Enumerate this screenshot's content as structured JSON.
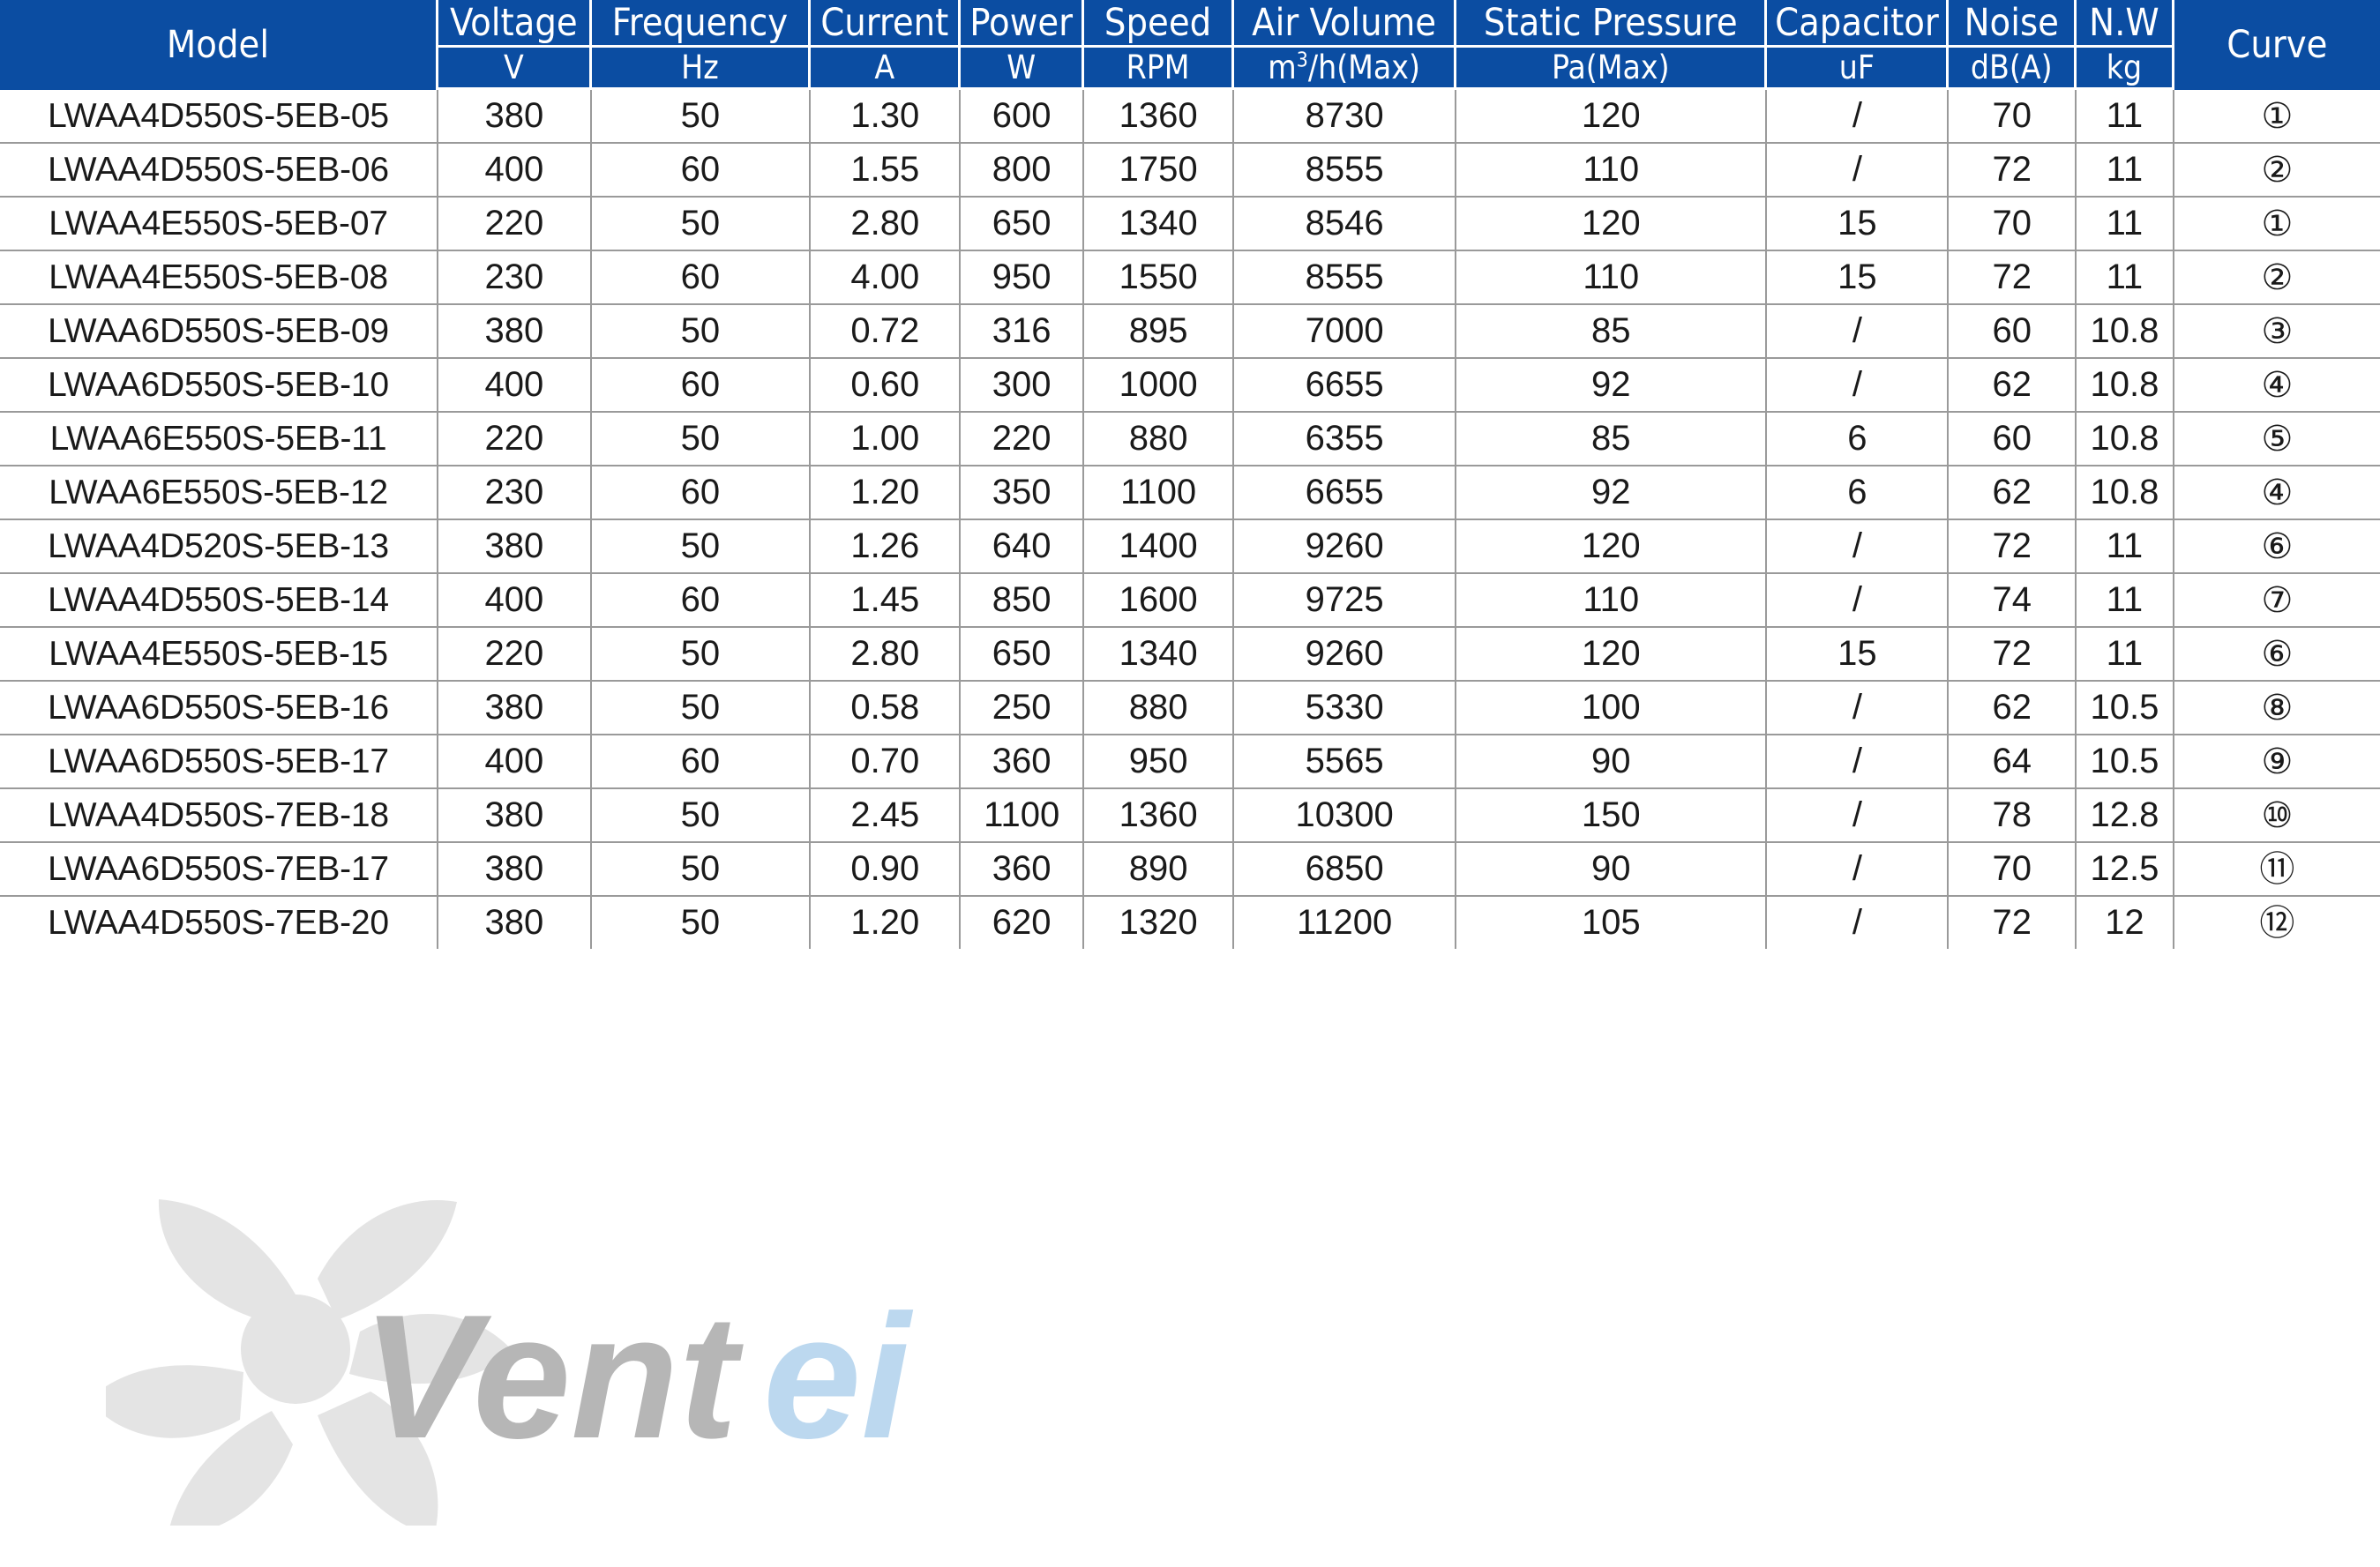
{
  "table": {
    "headers": {
      "model": "Model",
      "curve": "Curve",
      "groups": [
        {
          "name": "Voltage",
          "unit": "V"
        },
        {
          "name": "Frequency",
          "unit": "Hz"
        },
        {
          "name": "Current",
          "unit": "A"
        },
        {
          "name": "Power",
          "unit": "W"
        },
        {
          "name": "Speed",
          "unit": "RPM"
        },
        {
          "name": "Air Volume",
          "unit": "m³/h(Max)"
        },
        {
          "name": "Static Pressure",
          "unit": "Pa(Max)"
        },
        {
          "name": "Capacitor",
          "unit": "uF"
        },
        {
          "name": "Noise",
          "unit": "dB(A)"
        },
        {
          "name": "N.W",
          "unit": "kg"
        }
      ]
    },
    "rows": [
      {
        "model": "LWAA4D550S-5EB-05",
        "voltage": "380",
        "frequency": "50",
        "current": "1.30",
        "power": "600",
        "speed": "1360",
        "air_volume": "8730",
        "static_pressure": "120",
        "capacitor": "/",
        "noise": "70",
        "nw": "11",
        "curve": "①"
      },
      {
        "model": "LWAA4D550S-5EB-06",
        "voltage": "400",
        "frequency": "60",
        "current": "1.55",
        "power": "800",
        "speed": "1750",
        "air_volume": "8555",
        "static_pressure": "110",
        "capacitor": "/",
        "noise": "72",
        "nw": "11",
        "curve": "②"
      },
      {
        "model": "LWAA4E550S-5EB-07",
        "voltage": "220",
        "frequency": "50",
        "current": "2.80",
        "power": "650",
        "speed": "1340",
        "air_volume": "8546",
        "static_pressure": "120",
        "capacitor": "15",
        "noise": "70",
        "nw": "11",
        "curve": "①"
      },
      {
        "model": "LWAA4E550S-5EB-08",
        "voltage": "230",
        "frequency": "60",
        "current": "4.00",
        "power": "950",
        "speed": "1550",
        "air_volume": "8555",
        "static_pressure": "110",
        "capacitor": "15",
        "noise": "72",
        "nw": "11",
        "curve": "②"
      },
      {
        "model": "LWAA6D550S-5EB-09",
        "voltage": "380",
        "frequency": "50",
        "current": "0.72",
        "power": "316",
        "speed": "895",
        "air_volume": "7000",
        "static_pressure": "85",
        "capacitor": "/",
        "noise": "60",
        "nw": "10.8",
        "curve": "③"
      },
      {
        "model": "LWAA6D550S-5EB-10",
        "voltage": "400",
        "frequency": "60",
        "current": "0.60",
        "power": "300",
        "speed": "1000",
        "air_volume": "6655",
        "static_pressure": "92",
        "capacitor": "/",
        "noise": "62",
        "nw": "10.8",
        "curve": "④"
      },
      {
        "model": "LWAA6E550S-5EB-11",
        "voltage": "220",
        "frequency": "50",
        "current": "1.00",
        "power": "220",
        "speed": "880",
        "air_volume": "6355",
        "static_pressure": "85",
        "capacitor": "6",
        "noise": "60",
        "nw": "10.8",
        "curve": "⑤"
      },
      {
        "model": "LWAA6E550S-5EB-12",
        "voltage": "230",
        "frequency": "60",
        "current": "1.20",
        "power": "350",
        "speed": "1100",
        "air_volume": "6655",
        "static_pressure": "92",
        "capacitor": "6",
        "noise": "62",
        "nw": "10.8",
        "curve": "④"
      },
      {
        "model": "LWAA4D520S-5EB-13",
        "voltage": "380",
        "frequency": "50",
        "current": "1.26",
        "power": "640",
        "speed": "1400",
        "air_volume": "9260",
        "static_pressure": "120",
        "capacitor": "/",
        "noise": "72",
        "nw": "11",
        "curve": "⑥"
      },
      {
        "model": "LWAA4D550S-5EB-14",
        "voltage": "400",
        "frequency": "60",
        "current": "1.45",
        "power": "850",
        "speed": "1600",
        "air_volume": "9725",
        "static_pressure": "110",
        "capacitor": "/",
        "noise": "74",
        "nw": "11",
        "curve": "⑦"
      },
      {
        "model": "LWAA4E550S-5EB-15",
        "voltage": "220",
        "frequency": "50",
        "current": "2.80",
        "power": "650",
        "speed": "1340",
        "air_volume": "9260",
        "static_pressure": "120",
        "capacitor": "15",
        "noise": "72",
        "nw": "11",
        "curve": "⑥"
      },
      {
        "model": "LWAA6D550S-5EB-16",
        "voltage": "380",
        "frequency": "50",
        "current": "0.58",
        "power": "250",
        "speed": "880",
        "air_volume": "5330",
        "static_pressure": "100",
        "capacitor": "/",
        "noise": "62",
        "nw": "10.5",
        "curve": "⑧"
      },
      {
        "model": "LWAA6D550S-5EB-17",
        "voltage": "400",
        "frequency": "60",
        "current": "0.70",
        "power": "360",
        "speed": "950",
        "air_volume": "5565",
        "static_pressure": "90",
        "capacitor": "/",
        "noise": "64",
        "nw": "10.5",
        "curve": "⑨"
      },
      {
        "model": "LWAA4D550S-7EB-18",
        "voltage": "380",
        "frequency": "50",
        "current": "2.45",
        "power": "1100",
        "speed": "1360",
        "air_volume": "10300",
        "static_pressure": "150",
        "capacitor": "/",
        "noise": "78",
        "nw": "12.8",
        "curve": "⑩"
      },
      {
        "model": "LWAA6D550S-7EB-17",
        "voltage": "380",
        "frequency": "50",
        "current": "0.90",
        "power": "360",
        "speed": "890",
        "air_volume": "6850",
        "static_pressure": "90",
        "capacitor": "/",
        "noise": "70",
        "nw": "12.5",
        "curve": "⑪"
      },
      {
        "model": "LWAA4D550S-7EB-20",
        "voltage": "380",
        "frequency": "50",
        "current": "1.20",
        "power": "620",
        "speed": "1320",
        "air_volume": "11200",
        "static_pressure": "105",
        "capacitor": "/",
        "noise": "72",
        "nw": "12",
        "curve": "⑫"
      }
    ]
  },
  "watermark": {
    "text_primary": "Vent",
    "text_secondary": "ei",
    "color_primary": "#b6b6b6",
    "color_secondary": "#bcd8ef",
    "fan_color": "#e2e2e2"
  },
  "colors": {
    "header_background": "#0b4da2",
    "header_text": "#ffffff",
    "body_text": "#1a1a1a",
    "grid_line": "#9a9a9a"
  }
}
